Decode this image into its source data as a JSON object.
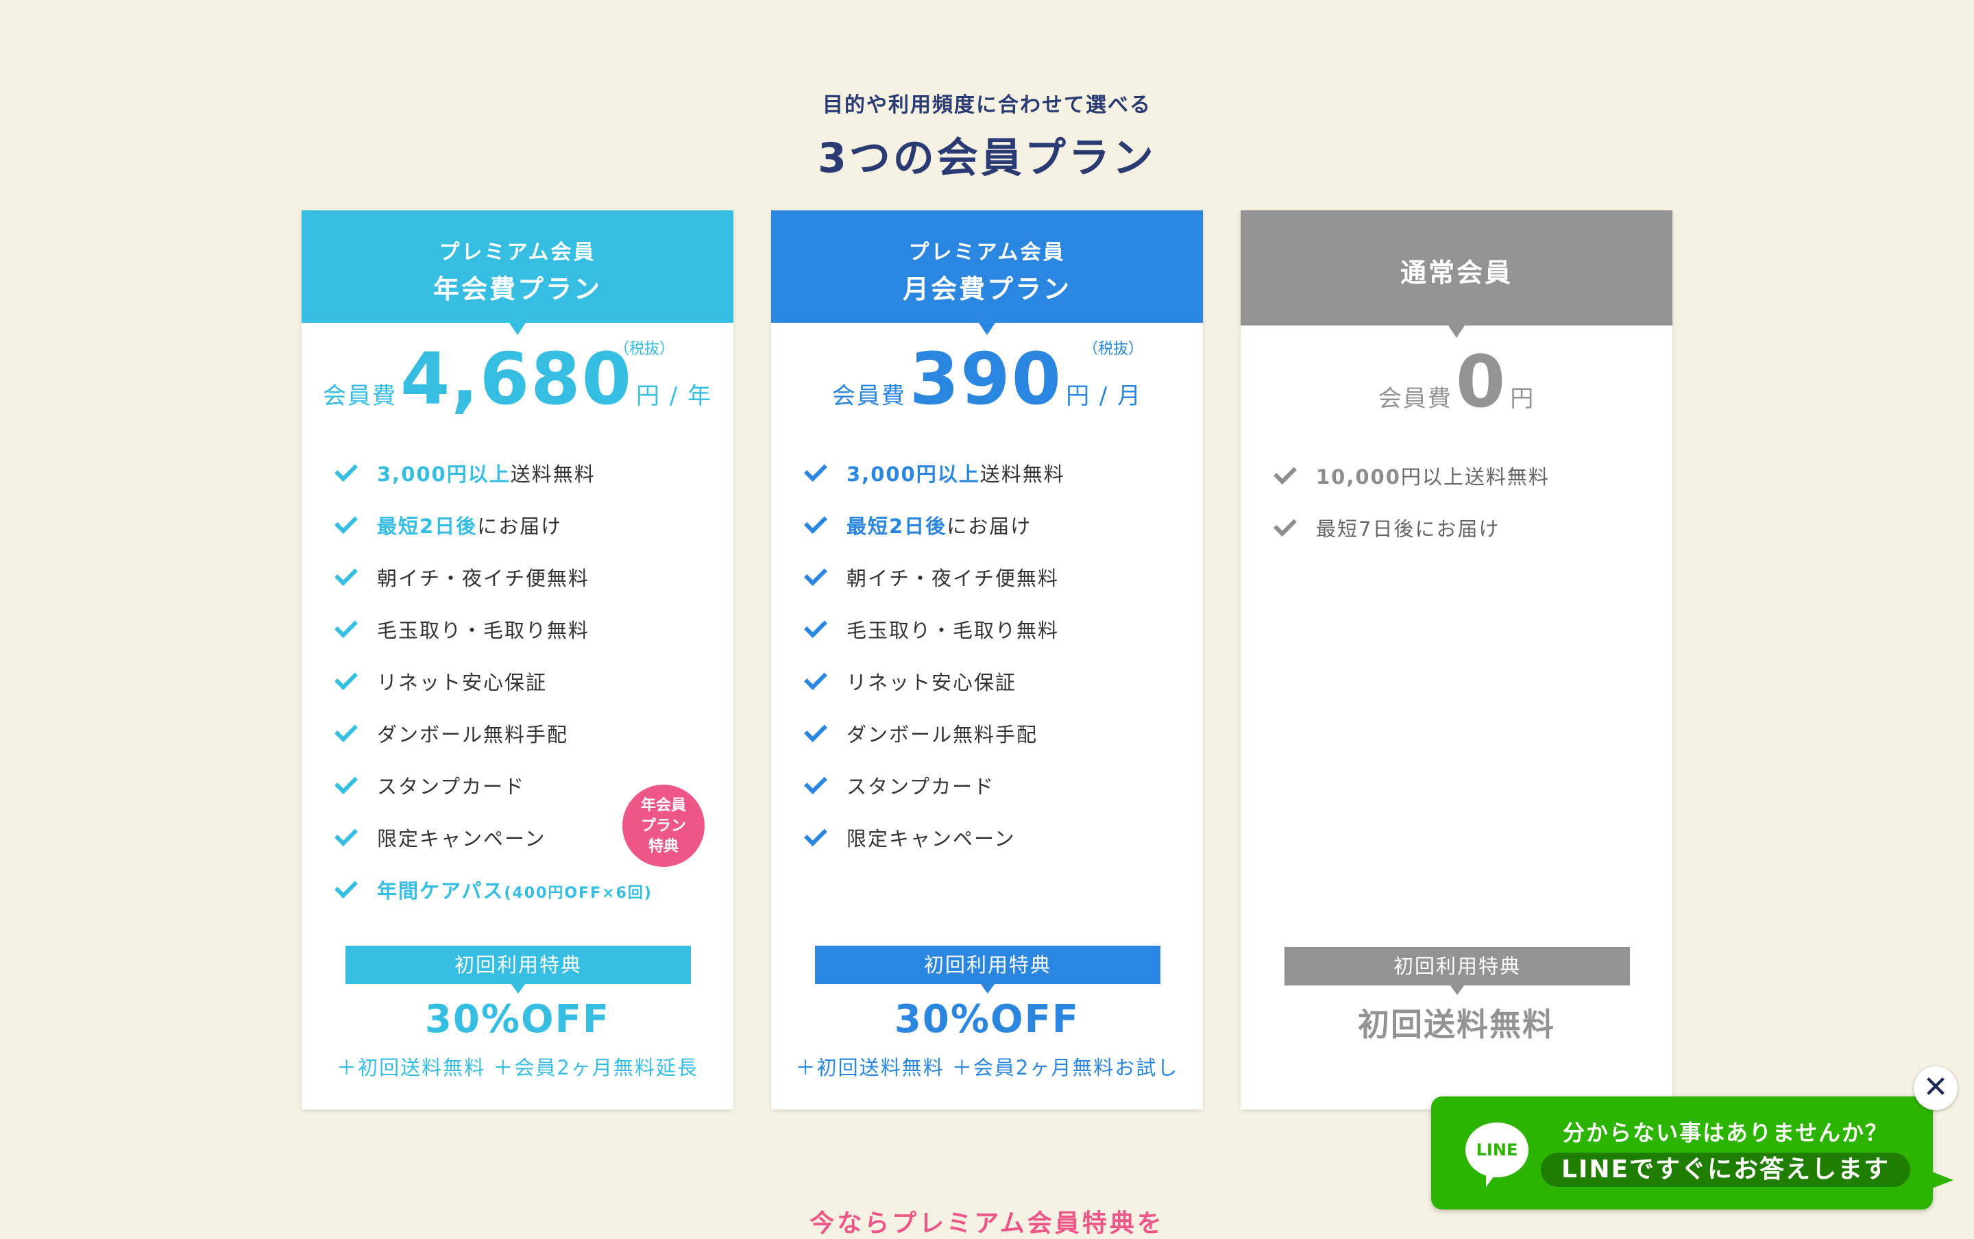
{
  "section": {
    "intro": "目的や利用頻度に合わせて選べる",
    "title": "3つの会員プラン"
  },
  "plans": [
    {
      "head_line1": "プレミアム会員",
      "head_line2": "年会費プラン",
      "price_label": "会員費",
      "price_value": "4,680",
      "price_unit": "円 / 年",
      "price_tax": "（税抜）",
      "features": [
        {
          "hl": "3,000円以上",
          "text": "送料無料"
        },
        {
          "hl": "最短2日後",
          "text": "にお届け"
        },
        {
          "hl": "",
          "text": "朝イチ・夜イチ便無料"
        },
        {
          "hl": "",
          "text": "毛玉取り・毛取り無料"
        },
        {
          "hl": "",
          "text": "リネット安心保証"
        },
        {
          "hl": "",
          "text": "ダンボール無料手配"
        },
        {
          "hl": "",
          "text": "スタンプカード"
        },
        {
          "hl": "",
          "text": "限定キャンペーン"
        },
        {
          "hl": "年間ケアパス",
          "text": "(400円OFF×6回)"
        }
      ],
      "badge": [
        "年会員",
        "プラン",
        "特典"
      ],
      "bonus_label": "初回利用特典",
      "bonus_main": "30%OFF",
      "bonus_sub": "＋初回送料無料 ＋会員2ヶ月無料延長",
      "accent": "#36bde2"
    },
    {
      "head_line1": "プレミアム会員",
      "head_line2": "月会費プラン",
      "price_label": "会員費",
      "price_value": "390",
      "price_unit": "円 / 月",
      "price_tax": "（税抜）",
      "features": [
        {
          "hl": "3,000円以上",
          "text": "送料無料"
        },
        {
          "hl": "最短2日後",
          "text": "にお届け"
        },
        {
          "hl": "",
          "text": "朝イチ・夜イチ便無料"
        },
        {
          "hl": "",
          "text": "毛玉取り・毛取り無料"
        },
        {
          "hl": "",
          "text": "リネット安心保証"
        },
        {
          "hl": "",
          "text": "ダンボール無料手配"
        },
        {
          "hl": "",
          "text": "スタンプカード"
        },
        {
          "hl": "",
          "text": "限定キャンペーン"
        }
      ],
      "bonus_label": "初回利用特典",
      "bonus_main": "30%OFF",
      "bonus_sub": "＋初回送料無料 ＋会員2ヶ月無料お試し",
      "accent": "#2a86de"
    },
    {
      "head_single": "通常会員",
      "price_label": "会員費",
      "price_value": "0",
      "price_unit": "円",
      "features": [
        {
          "hl": "10,000",
          "text": "円以上送料無料"
        },
        {
          "hl": "",
          "text": "最短7日後にお届け"
        }
      ],
      "bonus_label": "初回利用特典",
      "bonus_main": "初回送料無料",
      "accent": "#939393"
    }
  ],
  "footer_teaser": "今ならプレミアム会員特典を",
  "line_banner": {
    "logo": "LINE",
    "line1": "分からない事はありませんか？",
    "line2": "LINEですぐにお答えします",
    "close": "✕",
    "accent": "#2db400"
  }
}
